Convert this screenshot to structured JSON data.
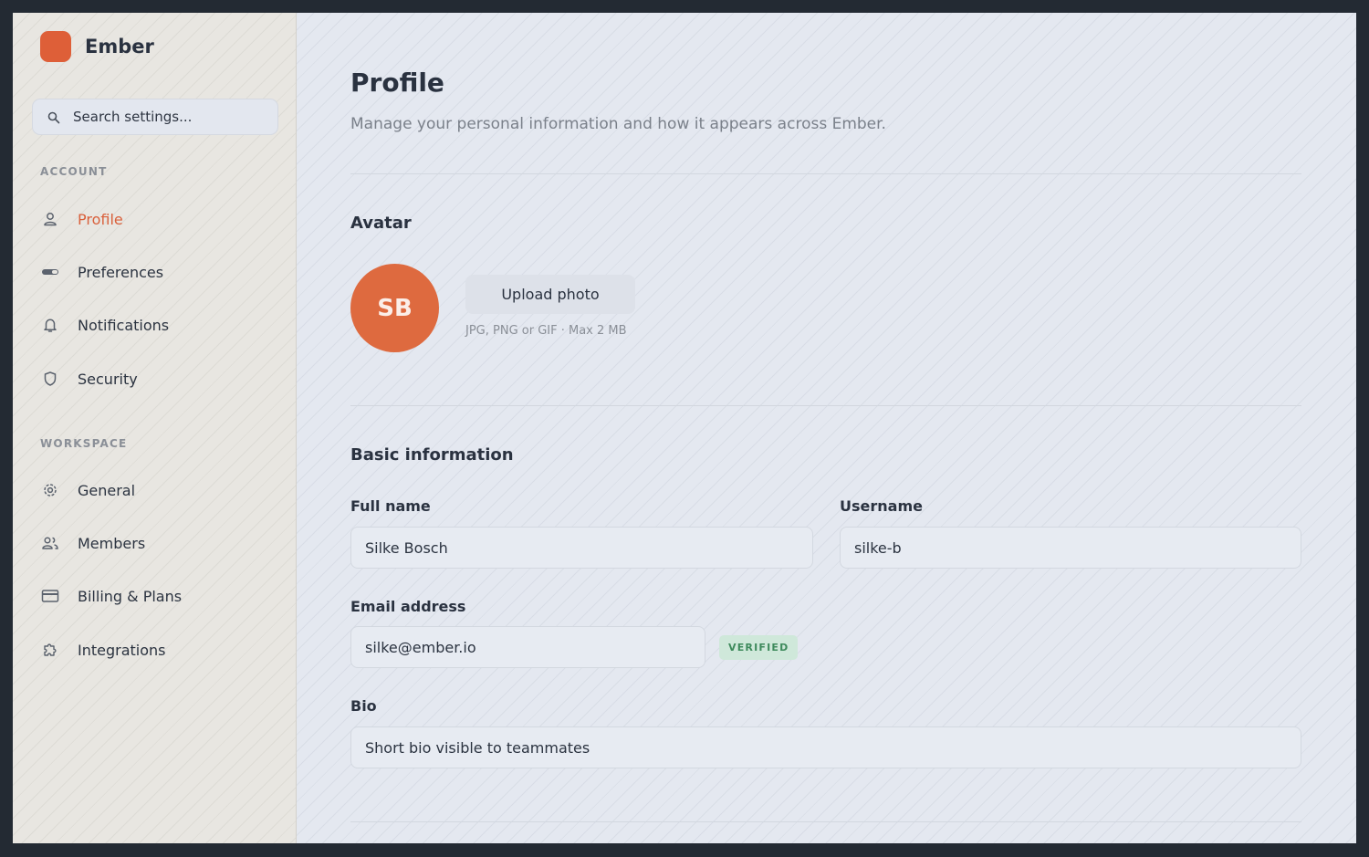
{
  "brand": {
    "name": "Ember"
  },
  "search": {
    "placeholder": "Search settings..."
  },
  "sidebar": {
    "account_label": "ACCOUNT",
    "account_items": [
      {
        "label": "Profile",
        "icon": "user-icon",
        "active": true
      },
      {
        "label": "Preferences",
        "icon": "toggle-icon"
      },
      {
        "label": "Notifications",
        "icon": "bell-icon"
      },
      {
        "label": "Security",
        "icon": "shield-icon"
      }
    ],
    "workspace_label": "WORKSPACE",
    "workspace_items": [
      {
        "label": "General",
        "icon": "gear-icon"
      },
      {
        "label": "Members",
        "icon": "users-icon"
      },
      {
        "label": "Billing & Plans",
        "icon": "credit-card-icon"
      },
      {
        "label": "Integrations",
        "icon": "puzzle-icon"
      }
    ]
  },
  "page": {
    "title": "Profile",
    "subtitle": "Manage your personal information and how it appears across Ember."
  },
  "avatar_section": {
    "title": "Avatar",
    "initials": "SB",
    "upload_label": "Upload photo",
    "hint": "JPG, PNG or GIF · Max 2 MB"
  },
  "basic_info": {
    "title": "Basic information",
    "full_name_label": "Full name",
    "full_name_value": "Silke Bosch",
    "username_label": "Username",
    "username_value": "silke-b",
    "email_label": "Email address",
    "email_value": "silke@ember.io",
    "email_badge": "VERIFIED",
    "bio_label": "Bio",
    "bio_placeholder": "Short bio visible to teammates"
  },
  "colors": {
    "accent": "#de5f38",
    "verified_bg": "#cfe8da",
    "verified_text": "#3e8a5c"
  }
}
